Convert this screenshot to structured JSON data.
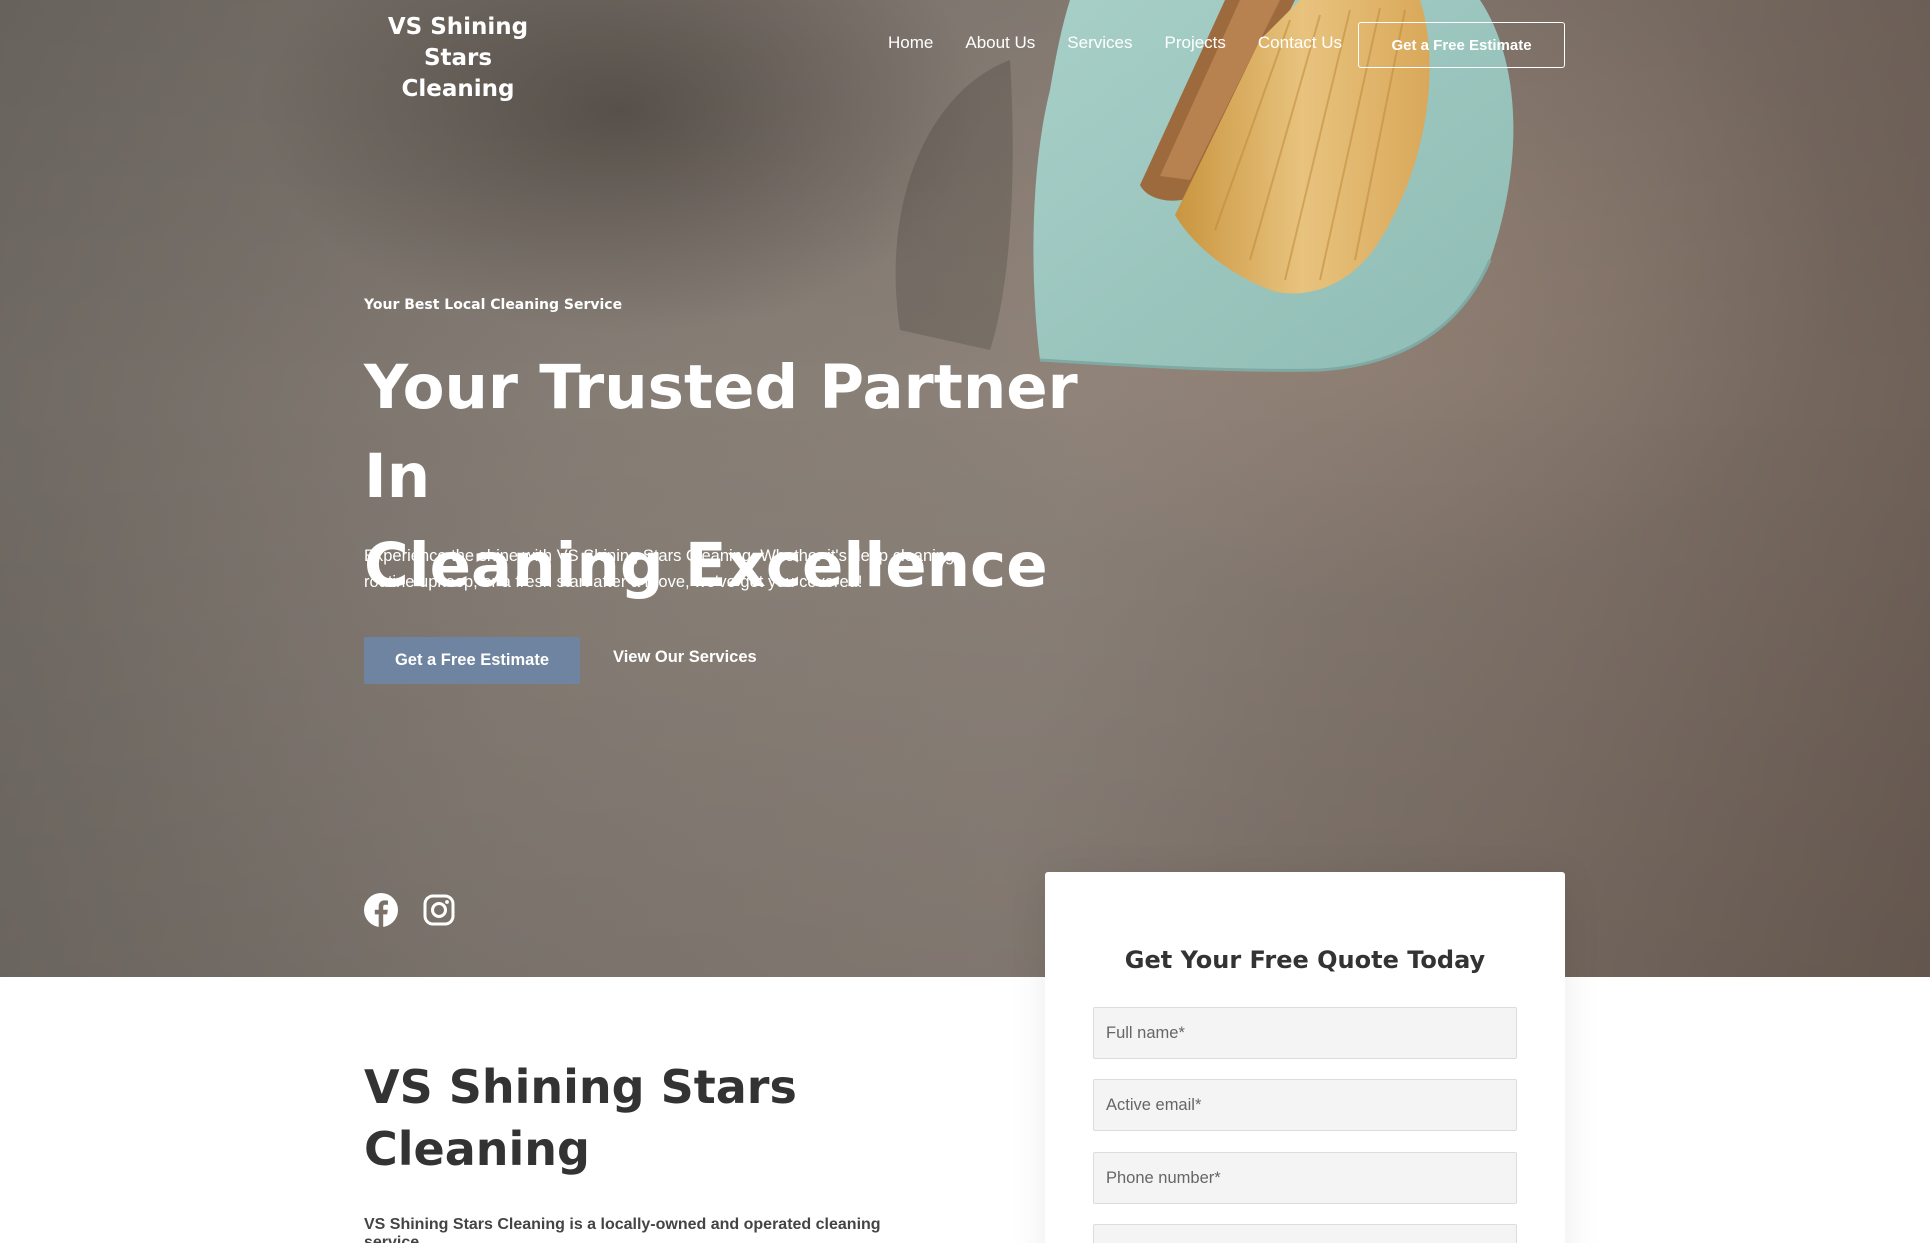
{
  "header": {
    "logo_line1": "VS Shining Stars",
    "logo_line2": "Cleaning",
    "nav": [
      "Home",
      "About Us",
      "Services",
      "Projects",
      "Contact Us"
    ],
    "cta_label": "Get a Free Estimate"
  },
  "hero": {
    "eyebrow": "Your Best Local Cleaning Service",
    "headline_line1": "Your Trusted Partner In",
    "headline_line2": "Cleaning Excellence",
    "lead": "Experience the shine with VS Shining Stars Cleaning. Whether it's deep cleaning, routine upkeep, or a fresh start after a move, we've got you covered!",
    "primary_button": "Get a Free Estimate",
    "secondary_link": "View Our Services",
    "social_icons": [
      "facebook-icon",
      "instagram-icon"
    ]
  },
  "quote_form": {
    "title": "Get Your Free Quote Today",
    "full_name_placeholder": "Full name*",
    "email_placeholder": "Active email*",
    "phone_placeholder": "Phone number*"
  },
  "about": {
    "title_line1": "VS Shining Stars",
    "title_line2": "Cleaning",
    "text": "VS Shining Stars Cleaning is a locally-owned and operated cleaning service"
  },
  "colors": {
    "accent": "#6e84a0",
    "hero_text": "#ffffff",
    "heading_dark": "#333333"
  }
}
